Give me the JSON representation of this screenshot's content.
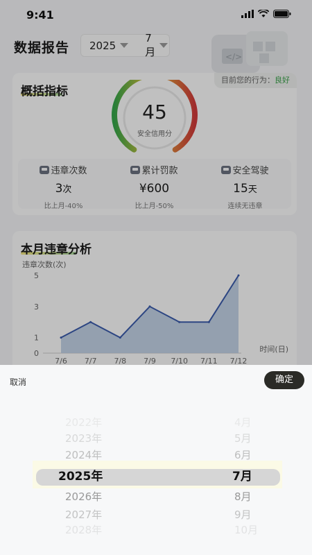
{
  "status_bar": {
    "time": "9:41"
  },
  "header": {
    "title": "数据报告",
    "year": "2025",
    "month": "7月"
  },
  "overview": {
    "title": "概括指标",
    "behavior_label": "目前您的行为：",
    "behavior_value": "良好",
    "score": "45",
    "score_label": "安全信用分",
    "metrics": [
      {
        "title": "违章次数",
        "value": "3",
        "unit": "次",
        "sub": "比上月-40%"
      },
      {
        "title": "累计罚款",
        "value": "¥600",
        "unit": "",
        "sub": "比上月-50%"
      },
      {
        "title": "安全驾驶",
        "value": "15",
        "unit": "天",
        "sub": "连续无违章"
      }
    ]
  },
  "analysis": {
    "title": "本月违章分析"
  },
  "chart_data": {
    "type": "area",
    "title": "本月违章分析",
    "ylabel": "违章次数(次)",
    "xlabel": "时间(日)",
    "categories": [
      "7/6",
      "7/7",
      "7/8",
      "7/9",
      "7/10",
      "7/11",
      "7/12"
    ],
    "values": [
      1,
      2,
      1,
      3,
      2,
      2,
      5
    ],
    "yticks": [
      0,
      1,
      3,
      5
    ],
    "ylim": [
      0,
      5
    ],
    "colors": {
      "line": "#3b5bab",
      "fill": "#b9cbe3"
    }
  },
  "picker": {
    "cancel_label": "取消",
    "confirm_label": "确定",
    "years": [
      "2022年",
      "2023年",
      "2024年",
      "2025年",
      "2026年",
      "2027年",
      "2028年"
    ],
    "months": [
      "4月",
      "5月",
      "6月",
      "7月",
      "8月",
      "9月",
      "10月"
    ],
    "selected_year": "2025年",
    "selected_month": "7月"
  }
}
